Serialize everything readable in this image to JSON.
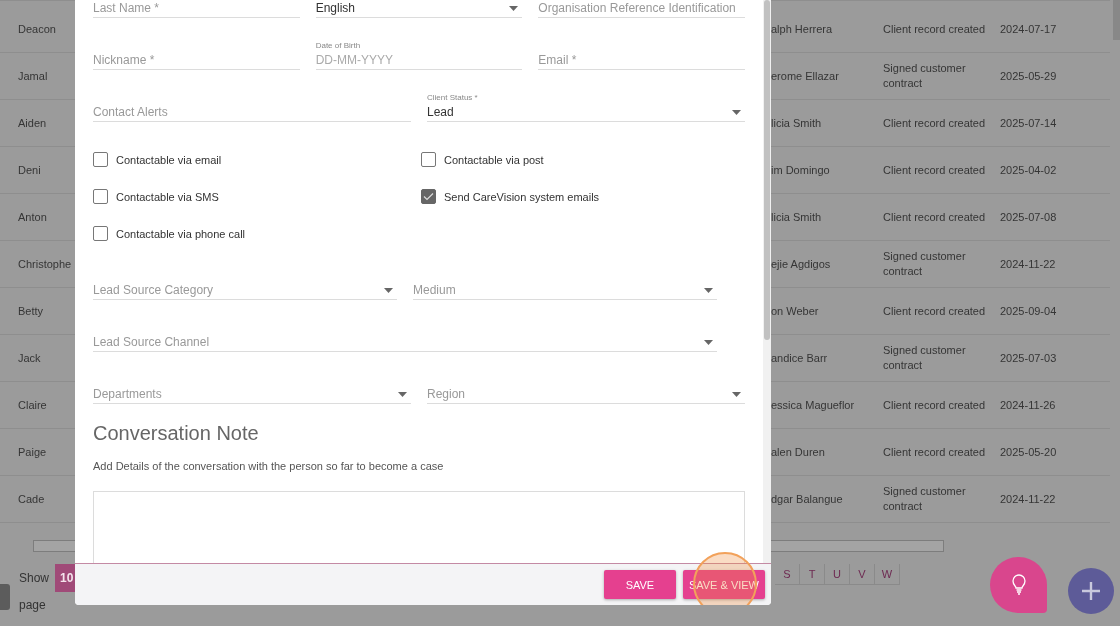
{
  "table": {
    "rows": [
      {
        "name": "Deacon",
        "person": "alph Herrera",
        "event": "Client record created",
        "date": "2024-07-17"
      },
      {
        "name": "Jamal",
        "person": "erome Ellazar",
        "event": "Signed customer contract",
        "date": "2025-05-29"
      },
      {
        "name": "Aiden",
        "person": "licia Smith",
        "event": "Client record created",
        "date": "2025-07-14"
      },
      {
        "name": "Deni",
        "person": "im Domingo",
        "event": "Client record created",
        "date": "2025-04-02"
      },
      {
        "name": "Anton",
        "person": "licia Smith",
        "event": "Client record created",
        "date": "2025-07-08"
      },
      {
        "name": "Christophe",
        "person": "ejie Agdigos",
        "event": "Signed customer contract",
        "date": "2024-11-22"
      },
      {
        "name": "Betty",
        "person": "on Weber",
        "event": "Client record created",
        "date": "2025-09-04"
      },
      {
        "name": "Jack",
        "person": "andice Barr",
        "event": "Signed customer contract",
        "date": "2025-07-03"
      },
      {
        "name": "Claire",
        "person": "essica Magueflor",
        "event": "Client record created",
        "date": "2024-11-26"
      },
      {
        "name": "Paige",
        "person": "alen Duren",
        "event": "Client record created",
        "date": "2025-05-20"
      },
      {
        "name": "Cade",
        "person": "dgar Balangue",
        "event": "Signed customer contract",
        "date": "2024-11-22"
      }
    ]
  },
  "pagination": {
    "show_label": "Show",
    "page_size": "10",
    "page_label": "page",
    "letters": [
      "S",
      "T",
      "U",
      "V",
      "W"
    ]
  },
  "dialog": {
    "field_rows": [
      [
        {
          "kind": "text",
          "placeholder": "Last Name *"
        },
        {
          "kind": "select",
          "value": "English"
        },
        {
          "kind": "text",
          "placeholder": "Organisation Reference Identification"
        }
      ],
      [
        {
          "kind": "text",
          "placeholder": "Nickname *"
        },
        {
          "kind": "date",
          "label": "Date of Birth",
          "placeholder": "DD-MM-YYYY"
        },
        {
          "kind": "text",
          "placeholder": "Email *"
        }
      ],
      [
        {
          "kind": "text",
          "placeholder": "Contact Alerts"
        },
        {
          "kind": "select",
          "label": "Client Status *",
          "value": "Lead"
        }
      ]
    ],
    "checkboxes": [
      {
        "label": "Contactable via email",
        "checked": false
      },
      {
        "label": "Contactable via post",
        "checked": false
      },
      {
        "label": "Contactable via SMS",
        "checked": false
      },
      {
        "label": "Send CareVision system emails",
        "checked": true
      },
      {
        "label": "Contactable via phone call",
        "checked": false
      }
    ],
    "select_rows": [
      [
        {
          "kind": "select",
          "placeholder": "Lead Source Category"
        },
        {
          "kind": "select",
          "placeholder": "Medium"
        }
      ],
      [
        {
          "kind": "select",
          "placeholder": "Lead Source Channel"
        }
      ],
      [
        {
          "kind": "select",
          "placeholder": "Departments"
        },
        {
          "kind": "select",
          "placeholder": "Region"
        }
      ]
    ],
    "section_title": "Conversation Note",
    "section_hint": "Add Details of the conversation with the person so far to become a case",
    "buttons": [
      {
        "label": "SAVE",
        "highlighted": false
      },
      {
        "label": "SAVE & VIEW",
        "highlighted": true
      }
    ]
  }
}
